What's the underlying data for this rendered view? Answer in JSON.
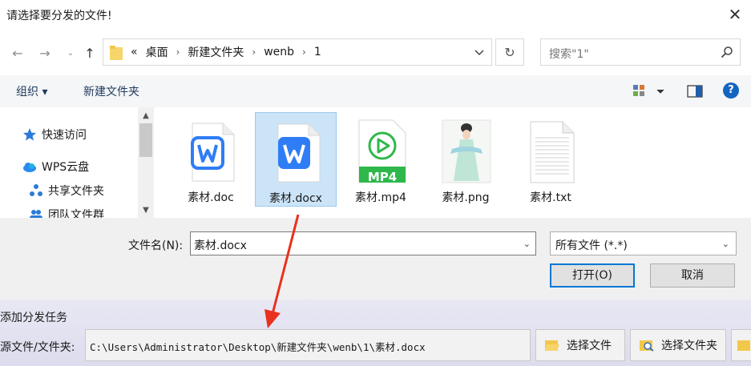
{
  "dialog": {
    "title": "请选择要分发的文件!"
  },
  "address": {
    "crumbs": [
      "«",
      "桌面",
      "›",
      "新建文件夹",
      "›",
      "wenb",
      "›",
      "1"
    ]
  },
  "search": {
    "placeholder": "搜索\"1\""
  },
  "toolbar": {
    "organize_label": "组织 ▾",
    "new_folder_label": "新建文件夹",
    "help_label": "?"
  },
  "navpane": {
    "items": [
      {
        "label": "快速访问",
        "icon": "star-icon"
      },
      {
        "label": "WPS云盘",
        "icon": "cloud-icon"
      },
      {
        "label": "共享文件夹",
        "icon": "share-icon"
      },
      {
        "label": "团队文件群",
        "icon": "team-icon"
      }
    ]
  },
  "files": [
    {
      "name": "素材.doc",
      "type": "wps-doc"
    },
    {
      "name": "素材.docx",
      "type": "wps-doc",
      "selected": true
    },
    {
      "name": "素材.mp4",
      "type": "mp4",
      "badge": "MP4"
    },
    {
      "name": "素材.png",
      "type": "image"
    },
    {
      "name": "素材.txt",
      "type": "txt"
    }
  ],
  "bottom": {
    "filename_label": "文件名(N):",
    "filename_value": "素材.docx",
    "filetype_value": "所有文件 (*.*)",
    "open_label": "打开(O)",
    "cancel_label": "取消"
  },
  "task": {
    "heading": "添加分发任务",
    "source_label": "源文件/文件夹:",
    "source_path": "C:\\Users\\Administrator\\Desktop\\新建文件夹\\wenb\\1\\素材.docx",
    "select_file_label": "选择文件",
    "select_folder_label": "选择文件夹"
  },
  "colors": {
    "accent": "#0078d7",
    "selection": "#cce4f7",
    "wps_blue": "#2f7df6",
    "mp4_green": "#2eb84b",
    "arrow_red": "#e8311f"
  }
}
